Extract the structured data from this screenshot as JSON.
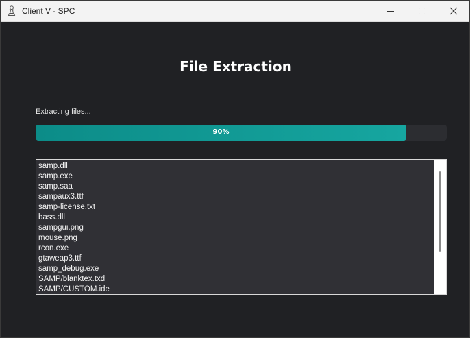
{
  "window": {
    "title": "Client V - SPC",
    "icon": "chess-pawn-icon",
    "controls": [
      "minimize-icon",
      "maximize-icon",
      "close-icon"
    ]
  },
  "main": {
    "heading": "File Extraction",
    "status_text": "Extracting files...",
    "progress": {
      "value": 0.9,
      "label": "90%",
      "fill_color": "#13a09b",
      "track_color": "#2c2d31"
    },
    "files": [
      "samp.dll",
      "samp.exe",
      "samp.saa",
      "sampaux3.ttf",
      "samp-license.txt",
      "bass.dll",
      "sampgui.png",
      "mouse.png",
      "rcon.exe",
      "gtaweap3.ttf",
      "samp_debug.exe",
      "SAMP/blanktex.txd",
      "SAMP/CUSTOM.ide"
    ]
  }
}
